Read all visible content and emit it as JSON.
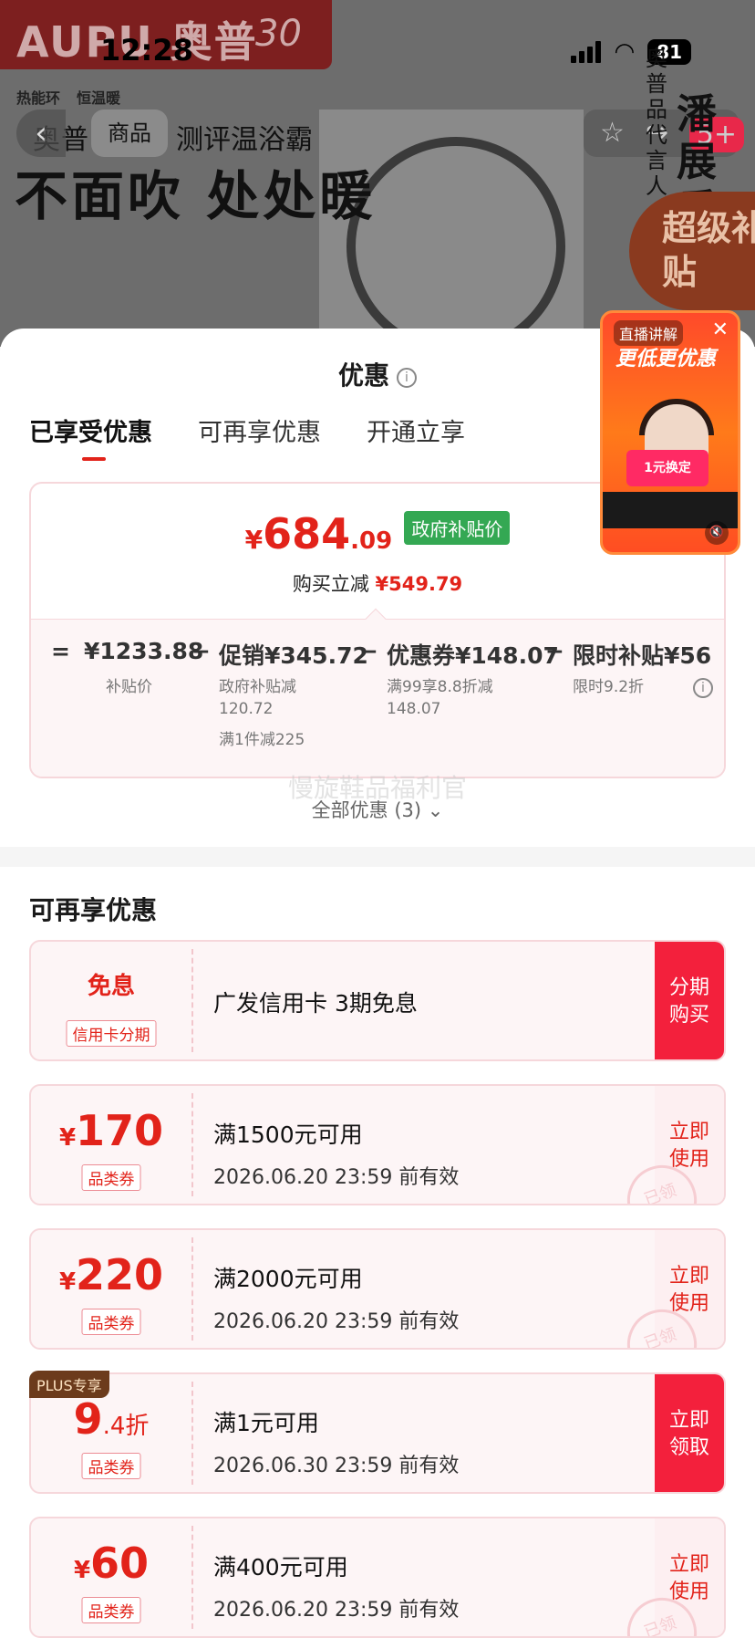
{
  "status": {
    "time": "12:28",
    "battery": "81"
  },
  "backdrop": {
    "brand": "AUPU",
    "brand_cn": "奥普",
    "brand_anniv": "30",
    "features": [
      "热能环",
      "恒温暖"
    ],
    "back_glyph": "‹",
    "tab_label": "商品",
    "title_left": "奥普",
    "title_right": "测评温浴霸",
    "slogan": "不面吹 处处暖",
    "side_vertical": "奥普品代言人",
    "side_big": "潘展乐",
    "super_subsidy": "超级补贴",
    "cart_badge": "5+"
  },
  "sheet": {
    "title": "优惠",
    "tabs": [
      "已享受优惠",
      "可再享优惠",
      "开通立享"
    ],
    "price": {
      "yen": "¥",
      "int": "684",
      "dec": ".09",
      "tag": "政府补贴价"
    },
    "reduce": {
      "label": "购买立减",
      "amount": "¥549.79"
    },
    "calc": {
      "eq": "=",
      "base": "¥1233.88",
      "base_label": "补贴价",
      "minus": "−",
      "promo": "促销¥345.72",
      "promo_sub1": "政府补贴减",
      "promo_sub2": "120.72",
      "promo_sub3": "满1件减225",
      "coupon": "优惠券¥148.07",
      "coupon_sub1": "满99享8.8折减",
      "coupon_sub2": "148.07",
      "limited": "限时补贴¥56",
      "limited_sub": "限时9.2折"
    },
    "all_offers": "全部优惠 (3)",
    "watermark": "慢旋鞋品福利官",
    "section_title": "可再享优惠"
  },
  "coupons": [
    {
      "big": "免息",
      "tag": "信用卡分期",
      "main": "广发信用卡 3期免息",
      "date": "",
      "btn": [
        "分期",
        "购买"
      ],
      "solid": true
    },
    {
      "yen": "¥",
      "num": "170",
      "tag": "品类券",
      "main": "满1500元可用",
      "date": "2026.06.20 23:59 前有效",
      "btn": [
        "立即",
        "使用"
      ],
      "solid": false,
      "stamp": "已领"
    },
    {
      "yen": "¥",
      "num": "220",
      "tag": "品类券",
      "main": "满2000元可用",
      "date": "2026.06.20 23:59 前有效",
      "btn": [
        "立即",
        "使用"
      ],
      "solid": false,
      "stamp": "已领"
    },
    {
      "num": "9",
      "dec": ".4折",
      "tag": "品类券",
      "main": "满1元可用",
      "date": "2026.06.30 23:59 前有效",
      "btn": [
        "立即",
        "领取"
      ],
      "solid": true,
      "plus": "PLUS专享"
    },
    {
      "yen": "¥",
      "num": "60",
      "tag": "品类券",
      "main": "满400元可用",
      "date": "2026.06.20 23:59 前有效",
      "btn": [
        "立即",
        "使用"
      ],
      "solid": false,
      "stamp": "已领"
    }
  ],
  "live": {
    "label": "直播讲解",
    "headline": "更低更优惠",
    "card": "1元换定",
    "close": "✕",
    "mute": "🔇"
  },
  "colors": {
    "accent": "#e2231a",
    "gov_tag": "#34a853",
    "plus_bg": "#6c3b1c"
  }
}
